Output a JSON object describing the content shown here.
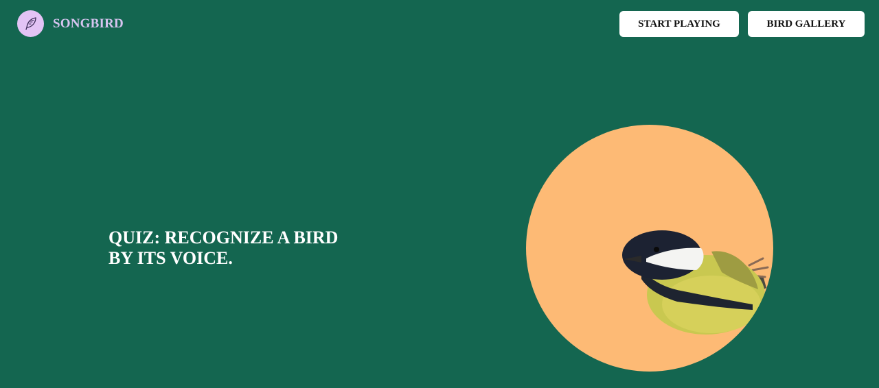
{
  "header": {
    "logo_text": "SONGBIRD",
    "logo_icon": "feather-icon",
    "nav": {
      "start_label": "START PLAYING",
      "gallery_label": "BIRD GALLERY"
    }
  },
  "hero": {
    "title_line1": "QUIZ: RECOGNIZE A BIRD",
    "title_line2": "BY ITS VOICE.",
    "image": "great-tit-bird-image"
  },
  "colors": {
    "background": "#146650",
    "logo_circle": "#e3c3f5",
    "logo_text": "#d7c4f0",
    "hero_circle": "#fdba75",
    "button_bg": "#ffffff"
  }
}
